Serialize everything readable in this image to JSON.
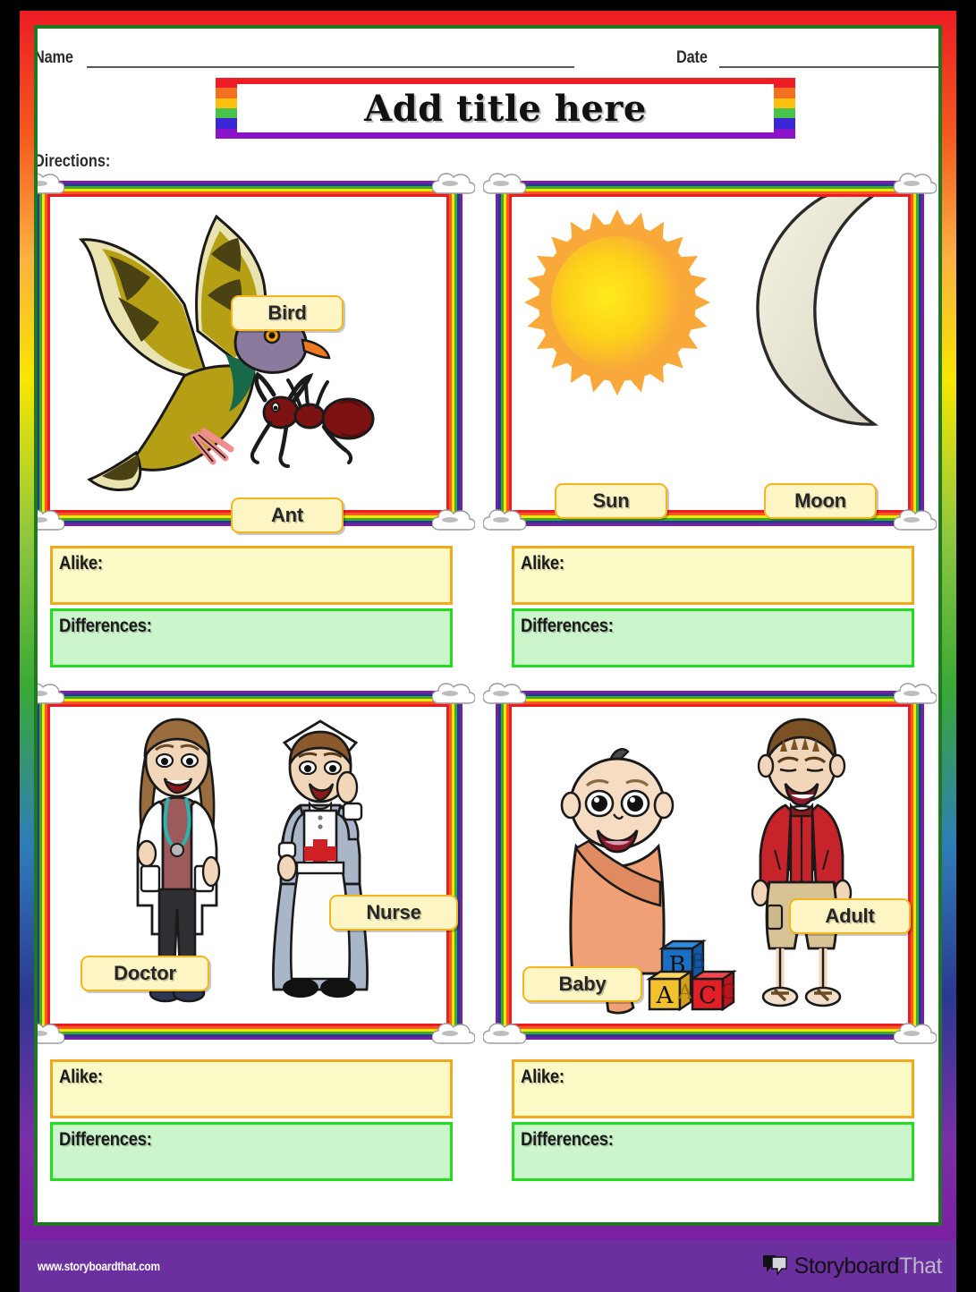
{
  "header": {
    "name_label": "Name",
    "date_label": "Date",
    "title": "Add title here",
    "directions_label": "Directions:"
  },
  "panels": [
    {
      "id": "panel-bird-ant",
      "items": [
        {
          "name": "bird",
          "label": "Bird"
        },
        {
          "name": "ant",
          "label": "Ant"
        }
      ],
      "alike_label": "Alike:",
      "differences_label": "Differences:"
    },
    {
      "id": "panel-sun-moon",
      "items": [
        {
          "name": "sun",
          "label": "Sun"
        },
        {
          "name": "moon",
          "label": "Moon"
        }
      ],
      "alike_label": "Alike:",
      "differences_label": "Differences:"
    },
    {
      "id": "panel-doctor-nurse",
      "items": [
        {
          "name": "doctor",
          "label": "Doctor"
        },
        {
          "name": "nurse",
          "label": "Nurse"
        }
      ],
      "alike_label": "Alike:",
      "differences_label": "Differences:"
    },
    {
      "id": "panel-baby-adult",
      "items": [
        {
          "name": "baby",
          "label": "Baby"
        },
        {
          "name": "adult",
          "label": "Adult"
        }
      ],
      "alike_label": "Alike:",
      "differences_label": "Differences:"
    }
  ],
  "blocks": {
    "letters": [
      "B",
      "A",
      "C"
    ]
  },
  "footer": {
    "url": "www.storyboardthat.com",
    "brand_first": "Storyboard",
    "brand_second": "That"
  },
  "colors": {
    "rainbow": [
      "#7b1fa2",
      "#2b3990",
      "#3aa935",
      "#f7e600",
      "#f4591f",
      "#ed1c24"
    ],
    "title_top": "#ee1c25",
    "title_bottom": "#8a12c9",
    "tag_fill": "#fdf6c4",
    "tag_border": "#f4b520",
    "alike_fill": "#fcfac6",
    "alike_border": "#f4a81d",
    "diff_fill": "#ccf5cc",
    "diff_border": "#22dd22",
    "footer_bg": "#6b2fa0",
    "frame_green": "#1f7a1f"
  }
}
